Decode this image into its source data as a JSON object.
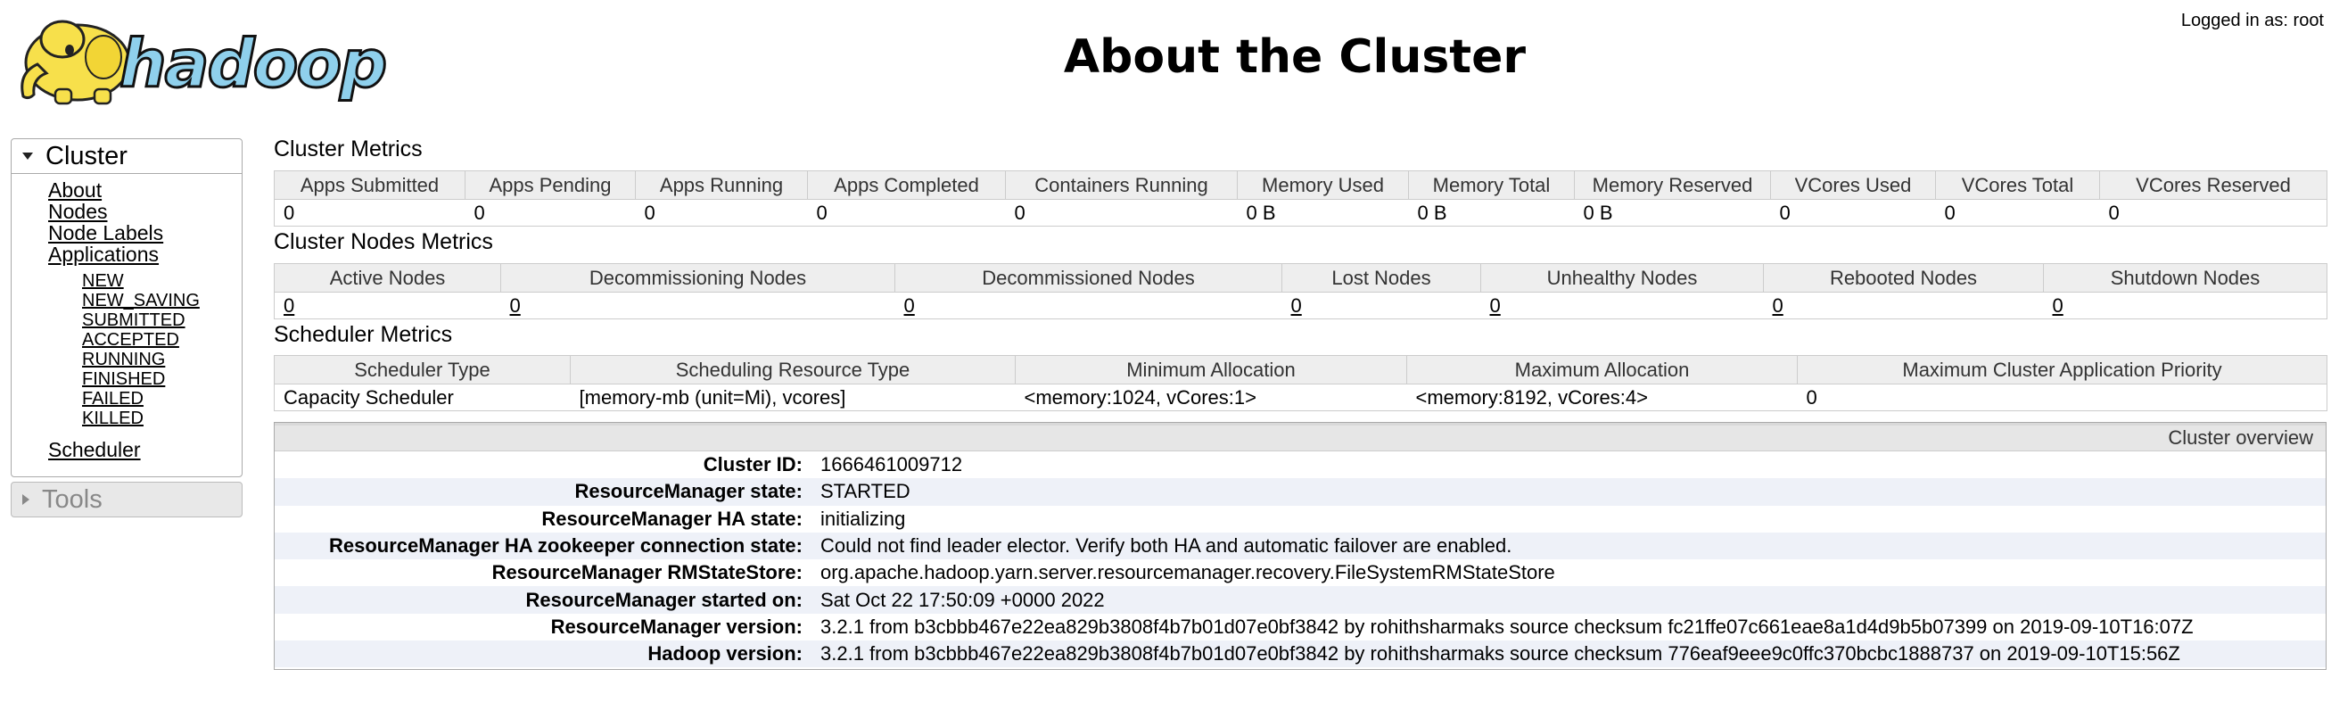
{
  "header": {
    "title": "About the Cluster",
    "logged_in": "Logged in as: root"
  },
  "sidebar": {
    "cluster_label": "Cluster",
    "links": [
      "About",
      "Nodes",
      "Node Labels",
      "Applications"
    ],
    "app_states": [
      "NEW",
      "NEW_SAVING",
      "SUBMITTED",
      "ACCEPTED",
      "RUNNING",
      "FINISHED",
      "FAILED",
      "KILLED"
    ],
    "scheduler_label": "Scheduler",
    "tools_label": "Tools"
  },
  "cluster_metrics": {
    "title": "Cluster Metrics",
    "headers": [
      "Apps Submitted",
      "Apps Pending",
      "Apps Running",
      "Apps Completed",
      "Containers Running",
      "Memory Used",
      "Memory Total",
      "Memory Reserved",
      "VCores Used",
      "VCores Total",
      "VCores Reserved"
    ],
    "values": [
      "0",
      "0",
      "0",
      "0",
      "0",
      "0 B",
      "0 B",
      "0 B",
      "0",
      "0",
      "0"
    ]
  },
  "node_metrics": {
    "title": "Cluster Nodes Metrics",
    "headers": [
      "Active Nodes",
      "Decommissioning Nodes",
      "Decommissioned Nodes",
      "Lost Nodes",
      "Unhealthy Nodes",
      "Rebooted Nodes",
      "Shutdown Nodes"
    ],
    "values": [
      "0",
      "0",
      "0",
      "0",
      "0",
      "0",
      "0"
    ]
  },
  "scheduler_metrics": {
    "title": "Scheduler Metrics",
    "headers": [
      "Scheduler Type",
      "Scheduling Resource Type",
      "Minimum Allocation",
      "Maximum Allocation",
      "Maximum Cluster Application Priority"
    ],
    "values": [
      "Capacity Scheduler",
      "[memory-mb (unit=Mi), vcores]",
      "<memory:1024, vCores:1>",
      "<memory:8192, vCores:4>",
      "0"
    ]
  },
  "overview": {
    "title": "Cluster overview",
    "rows": [
      {
        "label": "Cluster ID:",
        "value": "1666461009712"
      },
      {
        "label": "ResourceManager state:",
        "value": "STARTED"
      },
      {
        "label": "ResourceManager HA state:",
        "value": "initializing"
      },
      {
        "label": "ResourceManager HA zookeeper connection state:",
        "value": "Could not find leader elector. Verify both HA and automatic failover are enabled."
      },
      {
        "label": "ResourceManager RMStateStore:",
        "value": "org.apache.hadoop.yarn.server.resourcemanager.recovery.FileSystemRMStateStore"
      },
      {
        "label": "ResourceManager started on:",
        "value": "Sat Oct 22 17:50:09 +0000 2022"
      },
      {
        "label": "ResourceManager version:",
        "value": "3.2.1 from b3cbbb467e22ea829b3808f4b7b01d07e0bf3842 by rohithsharmaks source checksum fc21ffe07c661eae8a1d4d9b5b07399 on 2019-09-10T16:07Z"
      },
      {
        "label": "Hadoop version:",
        "value": "3.2.1 from b3cbbb467e22ea829b3808f4b7b01d07e0bf3842 by rohithsharmaks source checksum 776eaf9eee9c0ffc370bcbc1888737 on 2019-09-10T15:56Z"
      }
    ]
  },
  "logo": {
    "text": "hadoop",
    "body_color": "#f7e04b",
    "text_color": "#8fd0ec"
  }
}
